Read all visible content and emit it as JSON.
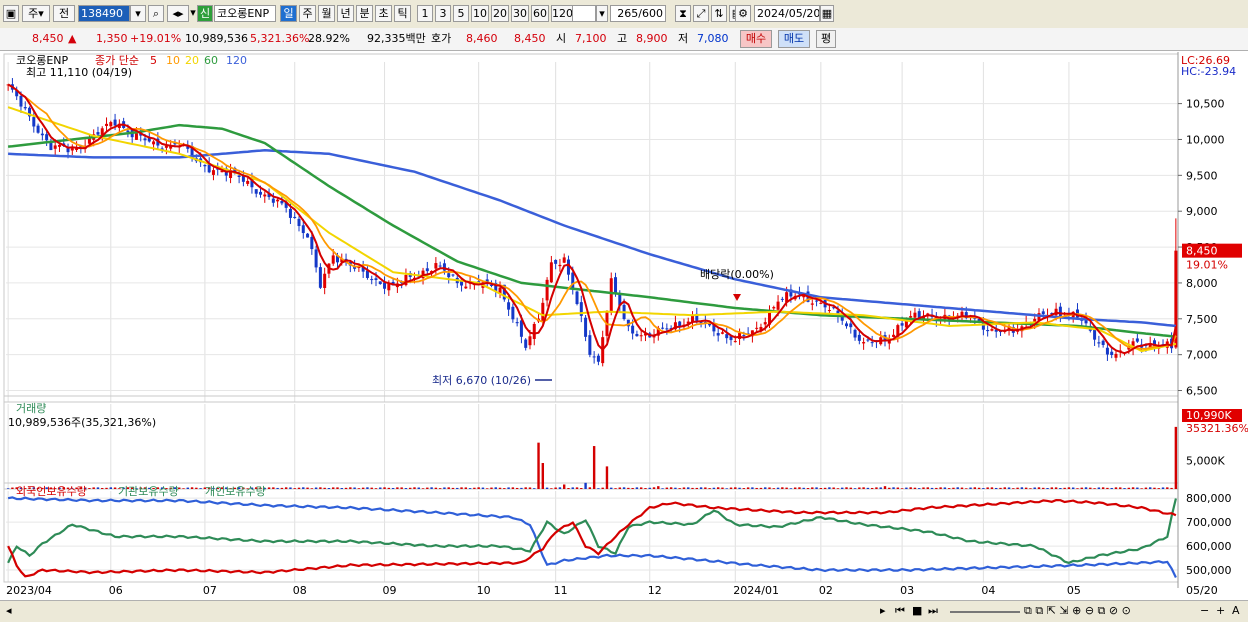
{
  "toolbar": {
    "period_select": "주",
    "prev_label": "전",
    "code": "138490",
    "stock_name": "코오롱ENP",
    "new_badge": "신",
    "tabs": [
      "일",
      "주",
      "월",
      "년",
      "분",
      "초",
      "틱"
    ],
    "num_tabs": [
      "1",
      "3",
      "5",
      "10",
      "20",
      "30",
      "60",
      "120"
    ],
    "count": "265",
    "count_total": "/600",
    "date": "2024/05/20"
  },
  "quote": {
    "price": "8,450",
    "arrow": "▲",
    "change": "1,350",
    "change_pct": "+19.01%",
    "volume": "10,989,536",
    "vol_pct": "5,321.36%",
    "turnover": "28.92%",
    "amount": "92,335백만",
    "bid_label": "호가",
    "bid1": "8,460",
    "bid2": "8,450",
    "open_label": "시",
    "open": "7,100",
    "high_label": "고",
    "high": "8,900",
    "low_label": "저",
    "low": "7,080",
    "buy_label": "매수",
    "sell_label": "매도",
    "eval_label": "평"
  },
  "chart_data": {
    "type": "line",
    "title": "코오롱ENP",
    "legend": {
      "ma_label": "종가 단순",
      "ma_periods": [
        "5",
        "10",
        "20",
        "60",
        "120"
      ],
      "ma_colors": [
        "#d40000",
        "#ff9900",
        "#f2d500",
        "#2e9b3e",
        "#3a5fd9"
      ]
    },
    "annotations": {
      "high": "최고 11,110 (04/19)",
      "low": "최저 6,670 (10/26)",
      "dividend": "배당락(0.00%)",
      "lc": "LC:26.69",
      "hc": "HC:-23.94"
    },
    "price_axis": {
      "ticks": [
        10500,
        10000,
        9500,
        9000,
        8500,
        8000,
        7500,
        7000,
        6500
      ],
      "tick_labels": [
        "10,500",
        "10,000",
        "9,500",
        "9,000",
        "8,500",
        "8,000",
        "7,500",
        "7,000",
        "6,500"
      ],
      "range": [
        6340,
        11080
      ],
      "last_label": "8,450",
      "last_pct": "19.01%"
    },
    "x_labels": [
      "2023/04",
      "06",
      "07",
      "08",
      "09",
      "10",
      "11",
      "12",
      "2024/01",
      "02",
      "03",
      "04",
      "05"
    ],
    "x_label_right": "05/20",
    "close_anchors": [
      [
        0,
        10750
      ],
      [
        5,
        10300
      ],
      [
        10,
        9900
      ],
      [
        15,
        9850
      ],
      [
        20,
        10050
      ],
      [
        25,
        10250
      ],
      [
        30,
        10050
      ],
      [
        35,
        9900
      ],
      [
        40,
        9950
      ],
      [
        45,
        9650
      ],
      [
        50,
        9550
      ],
      [
        55,
        9450
      ],
      [
        60,
        9200
      ],
      [
        65,
        9050
      ],
      [
        70,
        8650
      ],
      [
        73,
        7950
      ],
      [
        76,
        8400
      ],
      [
        80,
        8250
      ],
      [
        85,
        8050
      ],
      [
        90,
        7950
      ],
      [
        95,
        8100
      ],
      [
        100,
        8250
      ],
      [
        105,
        8000
      ],
      [
        110,
        8000
      ],
      [
        115,
        7900
      ],
      [
        118,
        7550
      ],
      [
        121,
        7100
      ],
      [
        124,
        7500
      ],
      [
        127,
        8300
      ],
      [
        130,
        8300
      ],
      [
        133,
        7700
      ],
      [
        136,
        7050
      ],
      [
        138,
        6900
      ],
      [
        141,
        8000
      ],
      [
        145,
        7350
      ],
      [
        150,
        7250
      ],
      [
        155,
        7400
      ],
      [
        160,
        7500
      ],
      [
        165,
        7350
      ],
      [
        170,
        7200
      ],
      [
        175,
        7350
      ],
      [
        180,
        7750
      ],
      [
        185,
        7850
      ],
      [
        190,
        7700
      ],
      [
        195,
        7500
      ],
      [
        200,
        7150
      ],
      [
        205,
        7200
      ],
      [
        210,
        7500
      ],
      [
        215,
        7550
      ],
      [
        220,
        7500
      ],
      [
        225,
        7550
      ],
      [
        230,
        7300
      ],
      [
        235,
        7350
      ],
      [
        240,
        7500
      ],
      [
        245,
        7600
      ],
      [
        250,
        7550
      ],
      [
        253,
        7300
      ],
      [
        257,
        7050
      ],
      [
        260,
        7000
      ],
      [
        263,
        7150
      ],
      [
        268,
        7150
      ],
      [
        272,
        7100
      ],
      [
        273,
        8450
      ]
    ],
    "ma_anchors": {
      "ma20": [
        [
          0,
          10450
        ],
        [
          20,
          10050
        ],
        [
          40,
          9800
        ],
        [
          60,
          9400
        ],
        [
          75,
          8700
        ],
        [
          90,
          8150
        ],
        [
          110,
          8000
        ],
        [
          125,
          7550
        ],
        [
          140,
          7600
        ],
        [
          160,
          7550
        ],
        [
          180,
          7600
        ],
        [
          200,
          7550
        ],
        [
          220,
          7400
        ],
        [
          240,
          7450
        ],
        [
          255,
          7350
        ],
        [
          265,
          7050
        ],
        [
          273,
          7150
        ]
      ],
      "ma60": [
        [
          0,
          9900
        ],
        [
          15,
          10000
        ],
        [
          30,
          10100
        ],
        [
          40,
          10200
        ],
        [
          50,
          10150
        ],
        [
          60,
          9950
        ],
        [
          75,
          9350
        ],
        [
          90,
          8800
        ],
        [
          105,
          8300
        ],
        [
          120,
          8000
        ],
        [
          135,
          7900
        ],
        [
          150,
          7800
        ],
        [
          170,
          7650
        ],
        [
          190,
          7550
        ],
        [
          210,
          7500
        ],
        [
          230,
          7450
        ],
        [
          250,
          7400
        ],
        [
          265,
          7300
        ],
        [
          273,
          7250
        ]
      ],
      "ma120": [
        [
          0,
          9800
        ],
        [
          20,
          9750
        ],
        [
          40,
          9750
        ],
        [
          60,
          9850
        ],
        [
          75,
          9800
        ],
        [
          95,
          9550
        ],
        [
          115,
          9150
        ],
        [
          130,
          8800
        ],
        [
          150,
          8400
        ],
        [
          170,
          8050
        ],
        [
          190,
          7800
        ],
        [
          210,
          7700
        ],
        [
          230,
          7600
        ],
        [
          250,
          7500
        ],
        [
          265,
          7450
        ],
        [
          273,
          7400
        ]
      ]
    },
    "volume": {
      "title": "거래량",
      "info": "10,989,536주(35,321,36%)",
      "tick_label": "5,000K",
      "last_label": "10,990K",
      "last_pct": "35321.36%",
      "max": 11500,
      "spikes": [
        [
          124,
          8200
        ],
        [
          125,
          4600
        ],
        [
          130,
          800
        ],
        [
          135,
          1100
        ],
        [
          137,
          7600
        ],
        [
          140,
          4000
        ],
        [
          152,
          500
        ],
        [
          205,
          500
        ],
        [
          273,
          10990
        ]
      ]
    },
    "holdings": {
      "legend": [
        "외국인보유수량",
        "기관보유수량",
        "개인보유수량"
      ],
      "colors": [
        "#d40000",
        "#2e8b57",
        "#2f5fd8"
      ],
      "ticks": [
        "800,000",
        "700,000",
        "600,000",
        "500,000"
      ],
      "tick_values": [
        800000,
        700000,
        600000,
        500000
      ],
      "range": [
        450000,
        830000
      ],
      "foreign": [
        [
          0,
          600000
        ],
        [
          2,
          520000
        ],
        [
          4,
          470000
        ],
        [
          8,
          500000
        ],
        [
          20,
          490000
        ],
        [
          40,
          500000
        ],
        [
          60,
          490000
        ],
        [
          70,
          505000
        ],
        [
          80,
          520000
        ],
        [
          100,
          525000
        ],
        [
          120,
          530000
        ],
        [
          125,
          590000
        ],
        [
          128,
          660000
        ],
        [
          132,
          700000
        ],
        [
          135,
          600000
        ],
        [
          138,
          570000
        ],
        [
          142,
          640000
        ],
        [
          145,
          690000
        ],
        [
          150,
          760000
        ],
        [
          155,
          780000
        ],
        [
          165,
          760000
        ],
        [
          175,
          750000
        ],
        [
          185,
          740000
        ],
        [
          195,
          740000
        ],
        [
          205,
          740000
        ],
        [
          215,
          760000
        ],
        [
          225,
          770000
        ],
        [
          235,
          780000
        ],
        [
          245,
          790000
        ],
        [
          255,
          780000
        ],
        [
          265,
          760000
        ],
        [
          270,
          740000
        ],
        [
          273,
          730000
        ]
      ],
      "inst": [
        [
          0,
          530000
        ],
        [
          2,
          600000
        ],
        [
          5,
          560000
        ],
        [
          8,
          610000
        ],
        [
          15,
          690000
        ],
        [
          25,
          640000
        ],
        [
          40,
          640000
        ],
        [
          60,
          620000
        ],
        [
          80,
          620000
        ],
        [
          100,
          600000
        ],
        [
          115,
          600000
        ],
        [
          122,
          580000
        ],
        [
          126,
          700000
        ],
        [
          130,
          650000
        ],
        [
          135,
          710000
        ],
        [
          138,
          600000
        ],
        [
          142,
          570000
        ],
        [
          145,
          680000
        ],
        [
          150,
          700000
        ],
        [
          160,
          690000
        ],
        [
          165,
          750000
        ],
        [
          170,
          690000
        ],
        [
          180,
          680000
        ],
        [
          190,
          720000
        ],
        [
          200,
          690000
        ],
        [
          215,
          660000
        ],
        [
          225,
          620000
        ],
        [
          240,
          600000
        ],
        [
          248,
          530000
        ],
        [
          255,
          560000
        ],
        [
          265,
          590000
        ],
        [
          271,
          640000
        ],
        [
          273,
          800000
        ]
      ],
      "indiv": [
        [
          0,
          800000
        ],
        [
          20,
          790000
        ],
        [
          40,
          790000
        ],
        [
          60,
          770000
        ],
        [
          80,
          760000
        ],
        [
          100,
          740000
        ],
        [
          118,
          720000
        ],
        [
          122,
          690000
        ],
        [
          126,
          520000
        ],
        [
          130,
          540000
        ],
        [
          140,
          560000
        ],
        [
          150,
          560000
        ],
        [
          160,
          545000
        ],
        [
          175,
          520000
        ],
        [
          190,
          500000
        ],
        [
          210,
          500000
        ],
        [
          230,
          510000
        ],
        [
          250,
          520000
        ],
        [
          265,
          530000
        ],
        [
          271,
          535000
        ],
        [
          273,
          470000
        ]
      ]
    }
  },
  "bottom": {
    "zoom_minus": "−",
    "zoom_plus": "+",
    "font_label": "A"
  }
}
